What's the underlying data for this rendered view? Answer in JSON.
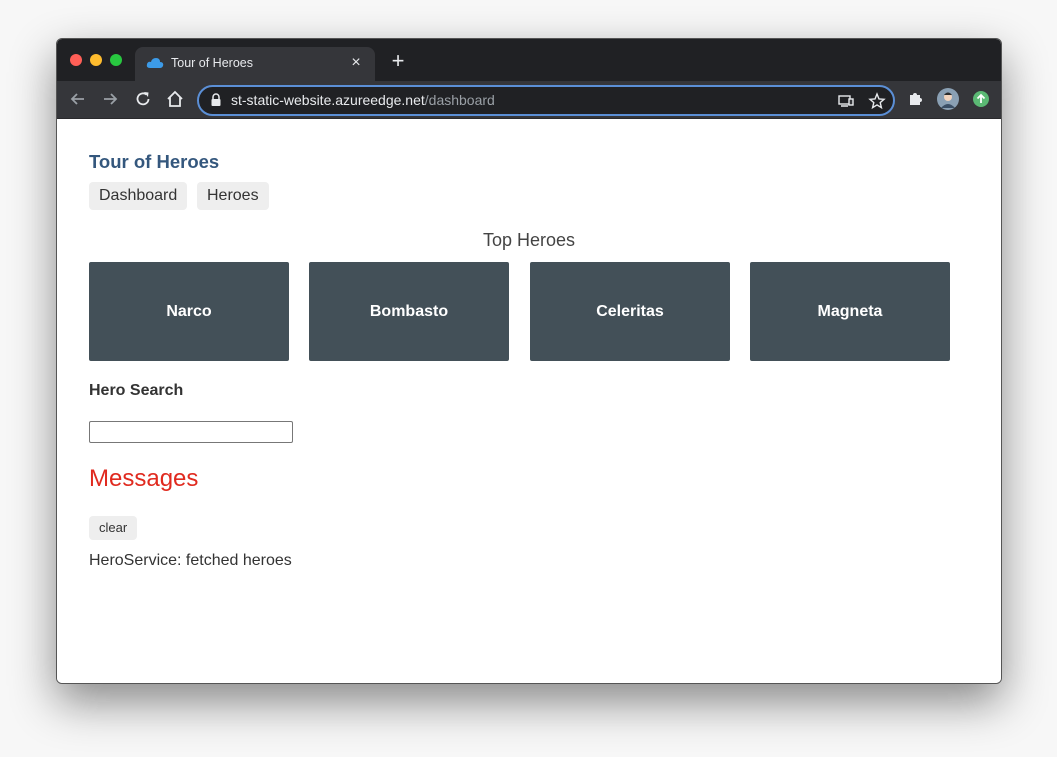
{
  "browser": {
    "tab_title": "Tour of Heroes",
    "close_tab_symbol": "×",
    "new_tab_symbol": "+",
    "url_host": "st-static-website.azureedge.net",
    "url_path": "/dashboard",
    "icons": [
      "back-arrow-icon",
      "forward-arrow-icon",
      "reload-icon",
      "home-icon",
      "lock-icon",
      "cast-icon",
      "bookmark-star-icon",
      "extensions-puzzle-icon",
      "profile-avatar-icon",
      "update-icon"
    ]
  },
  "app": {
    "title": "Tour of Heroes",
    "nav": {
      "dashboard": "Dashboard",
      "heroes": "Heroes"
    },
    "top_heroes_heading": "Top Heroes",
    "top_heroes": [
      "Narco",
      "Bombasto",
      "Celeritas",
      "Magneta"
    ],
    "search": {
      "label": "Hero Search",
      "value": ""
    },
    "messages": {
      "heading": "Messages",
      "clear_label": "clear",
      "items": [
        "HeroService: fetched heroes"
      ]
    }
  },
  "colors": {
    "title_blue": "#34577d",
    "hero_card": "#435058",
    "messages_red": "#e02a1f",
    "button_gray": "#eeeeee"
  }
}
